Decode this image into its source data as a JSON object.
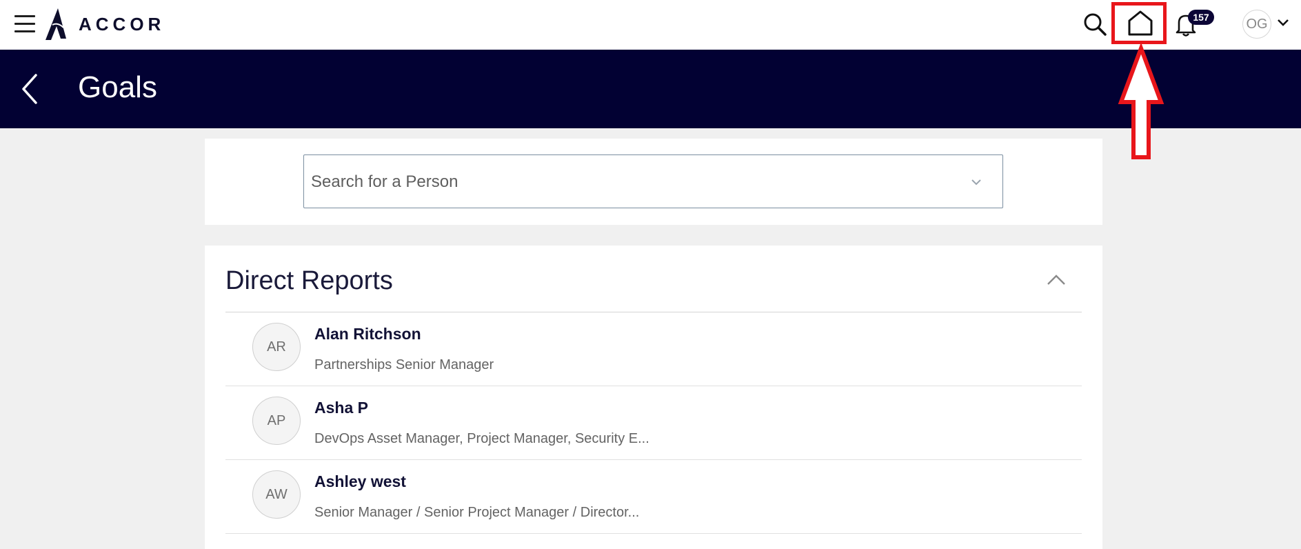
{
  "topbar": {
    "brand_name": "ACCOR",
    "notification_count": "157",
    "user_initials": "OG"
  },
  "header": {
    "title": "Goals"
  },
  "search": {
    "placeholder": "Search for a Person"
  },
  "direct_reports": {
    "title": "Direct Reports",
    "items": [
      {
        "initials": "AR",
        "name": "Alan Ritchson",
        "role": "Partnerships Senior Manager"
      },
      {
        "initials": "AP",
        "name": "Asha P",
        "role": "DevOps Asset Manager, Project Manager, Security E..."
      },
      {
        "initials": "AW",
        "name": "Ashley west",
        "role": "Senior Manager / Senior Project Manager / Director..."
      }
    ]
  },
  "colors": {
    "header_bg": "#020133",
    "highlight": "#e8161b",
    "badge_bg": "#0b0536"
  }
}
